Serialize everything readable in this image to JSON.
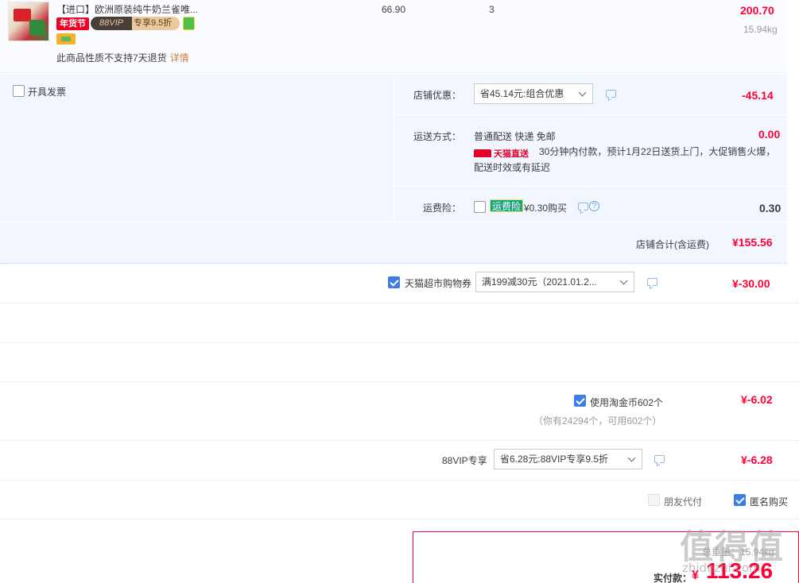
{
  "product": {
    "title": "【进口】欧洲原装纯牛奶兰雀唯...",
    "tag_nianhuojie": "年货节",
    "vip_label": "88VIP",
    "vip_discount": "专享9.5折",
    "no_return_text": "此商品性质不支持7天退货",
    "detail_link": "详情",
    "unit_price": "66.90",
    "quantity": "3",
    "subtotal": "200.70",
    "weight": "15.94kg"
  },
  "invoice": {
    "label": "开具发票",
    "checked": false
  },
  "shop_discount": {
    "label": "店铺优惠：",
    "selected": "省45.14元:组合优惠",
    "amount": "-45.14"
  },
  "shipping": {
    "label": "运送方式：",
    "method": "普通配送 快递 免邮",
    "tmall_tag": "天猫直送",
    "notice": "30分钟内付款，预计1月22日送货上门，大促销售火爆，",
    "notice_line2": "配送时效或有延迟",
    "amount": "0.00"
  },
  "freight_insurance": {
    "label": "运费险：",
    "tag": "运费险",
    "price": "¥0.30购买",
    "help": "?",
    "amount": "0.30",
    "checked": false
  },
  "shop_total": {
    "label": "店铺合计(含运费)",
    "amount": "¥155.56"
  },
  "coupon": {
    "label": "天猫超市购物券",
    "selected": "满199减30元（2021.01.2...",
    "amount": "¥-30.00",
    "checked": true
  },
  "taojinbi": {
    "label": "使用淘金币602个",
    "sub": "（你有24294个，可用602个）",
    "amount": "¥-6.02",
    "checked": true
  },
  "vip88": {
    "label": "88VIP专享",
    "selected": "省6.28元:88VIP专享9.5折",
    "amount": "¥-6.28"
  },
  "options": {
    "friend_pay": "朋友代付",
    "anonymous": "匿名购买",
    "anonymous_checked": true
  },
  "pay": {
    "total_weight": "总重量：15.94kg",
    "label": "实付款：",
    "currency": "¥",
    "amount": "113.26"
  },
  "watermark": {
    "text": "值得值",
    "url": "zhidezhi.com"
  },
  "colors": {
    "accent_red": "#ff0036",
    "check_blue": "#3d7ee6",
    "shop_bg": "#f2f7ff"
  }
}
